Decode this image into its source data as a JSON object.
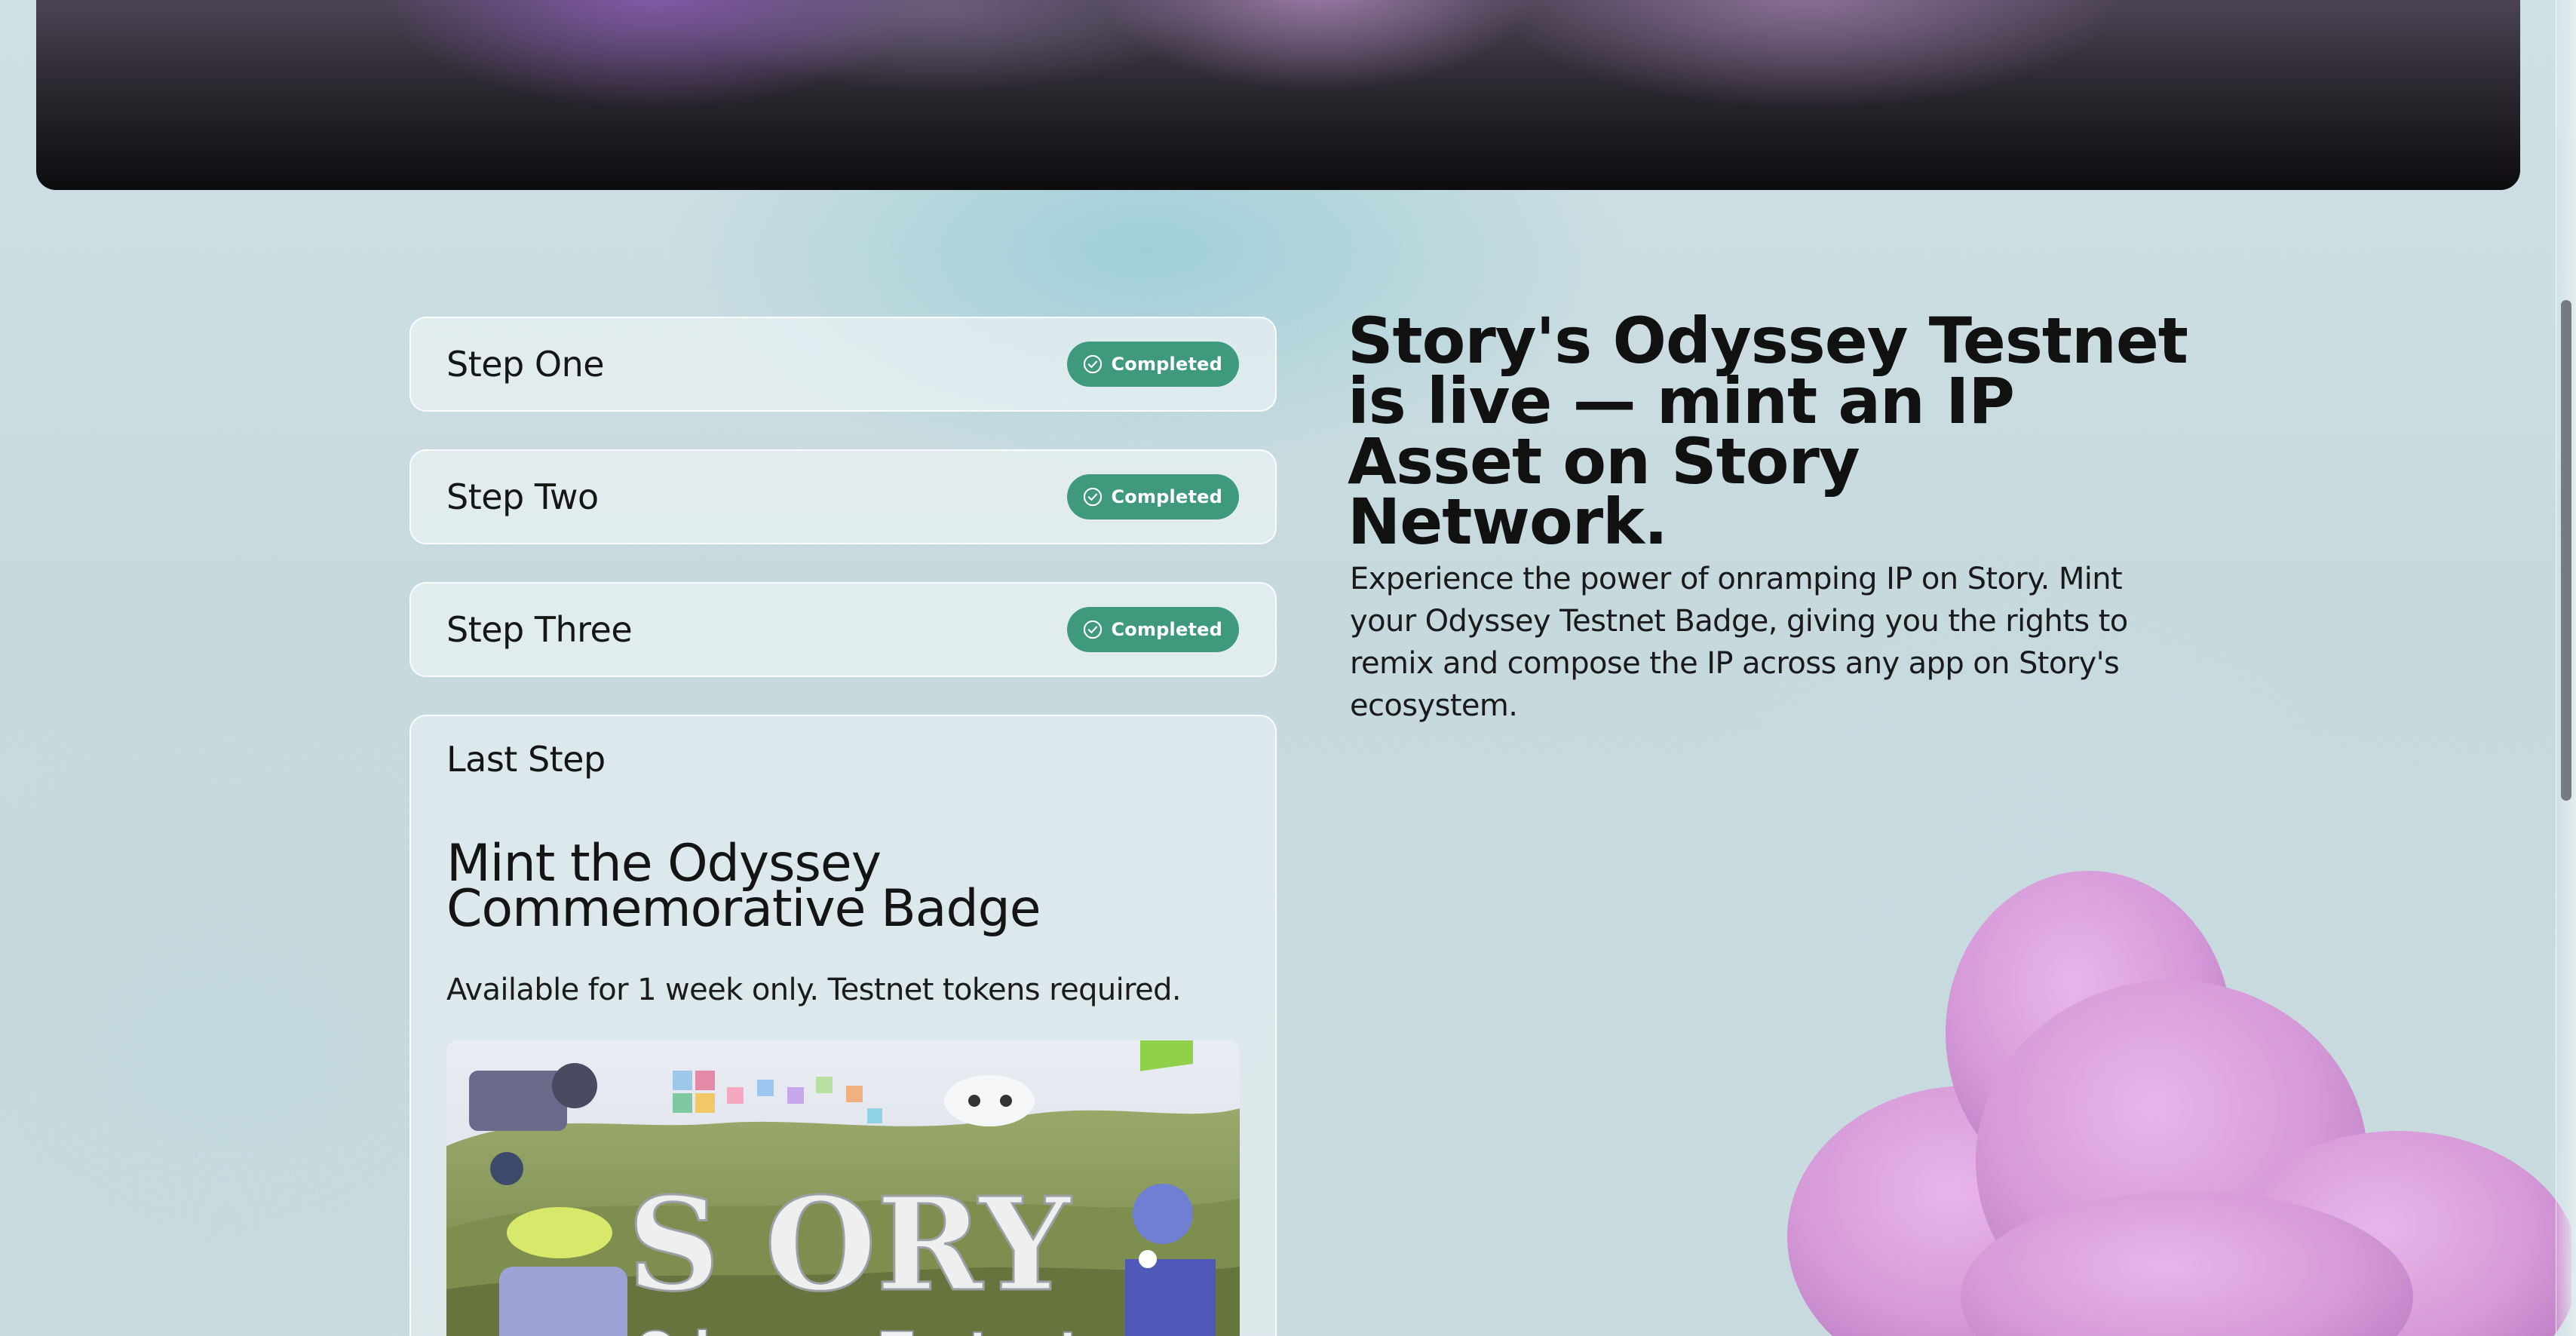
{
  "steps": [
    {
      "title": "Step One",
      "status": "Completed"
    },
    {
      "title": "Step Two",
      "status": "Completed"
    },
    {
      "title": "Step Three",
      "status": "Completed"
    }
  ],
  "last_step": {
    "label": "Last Step",
    "title": "Mint the Odyssey Commemorative Badge",
    "subtitle": "Available for 1 week only. Testnet tokens required.",
    "art_text_main": "S ORY",
    "art_text_sub": "Odyssey Testnet"
  },
  "hero": {
    "headline": "Story's Odyssey Testnet is live — mint an IP Asset on Story Network.",
    "body": "Experience the power of onramping IP on Story. Mint your Odyssey Testnet Badge, giving you the rights to remix and compose the IP across any app on Story's ecosystem."
  },
  "colors": {
    "completed_badge": "#3f9a7d",
    "background": "#cfe0e4",
    "blob": "#d9a3de"
  },
  "icons": {
    "completed": "check-circle-icon"
  }
}
